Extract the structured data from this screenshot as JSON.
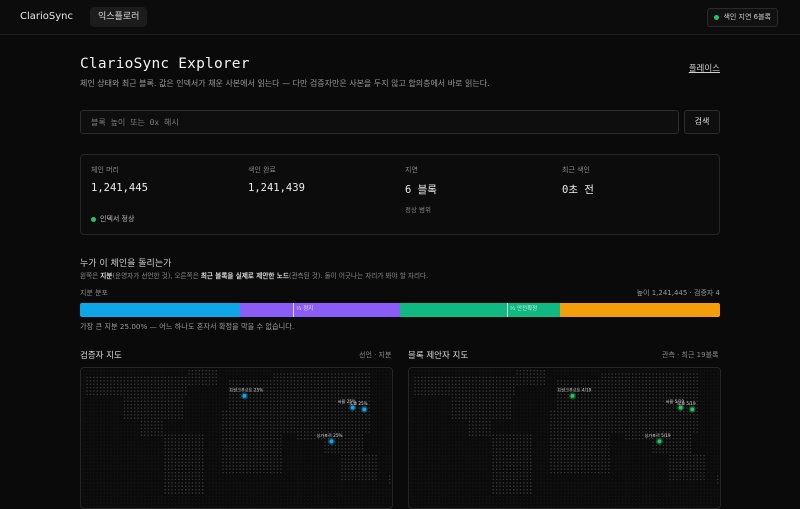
{
  "app": {
    "brand": "ClarioSync",
    "nav_tab": "익스플로러",
    "indexer_lag": "색인 지연 6블록"
  },
  "header": {
    "title": "ClarioSync Explorer",
    "subtitle": "체인 상태와 최근 블록. 값은 인덱서가 채운 사본에서 읽는다 — 다만 검증자만은 사본을 두지 않고 합의층에서 바로 읽는다.",
    "playbook_link": "플레이스"
  },
  "search": {
    "placeholder": "블록 높이 또는 0x 해시",
    "button": "검색"
  },
  "stats": {
    "chain_head": {
      "label": "체인 머리",
      "value": "1,241,445"
    },
    "indexed": {
      "label": "색인 완료",
      "value": "1,241,439"
    },
    "lag": {
      "label": "지연",
      "value": "6 블록",
      "note": "정상 범위"
    },
    "last_indexed": {
      "label": "최근 색인",
      "value": "0초 전"
    },
    "indexer_status": "인덱서 정상"
  },
  "control": {
    "title": "누가 이 체인을 돌리는가",
    "desc_1": "왼쪽은 ",
    "desc_bold_1": "지분",
    "desc_2": "(운영자가 선언한 것), 오른쪽은 ",
    "desc_bold_2": "최근 블록을 실제로 제안한 노드",
    "desc_3": "(관측된 것). 둘이 어긋나는 자리가 봐야 할 자리다.",
    "distribution_label": "지분 분포",
    "height_info": "높이 1,241,445 · 검증자 4",
    "stake_shares": [
      {
        "share": 0.25,
        "color": "#0ea5e9"
      },
      {
        "share": 0.25,
        "color": "#8b5cf6"
      },
      {
        "share": 0.25,
        "color": "#10b981"
      },
      {
        "share": 0.25,
        "color": "#f59e0b"
      }
    ],
    "thresholds": [
      {
        "position": 0.333,
        "label": "⅓ 정지"
      },
      {
        "position": 0.667,
        "label": "⅔ 안전확정"
      }
    ],
    "caption": "가장 큰 지분 25.00% — 어느 하나도 혼자서 확정을 막을 수 없습니다."
  },
  "validator_map": {
    "title": "검증자 지도",
    "subtitle": "선언 · 지분",
    "pin_color": "#0ea5e9",
    "pins": [
      {
        "label": "프랑크푸르트 25%",
        "lon": 8.7,
        "lat": 50.1
      },
      {
        "label": "서울 25%",
        "lon": 127.0,
        "lat": 37.6
      },
      {
        "label": "도쿄 25%",
        "lon": 139.7,
        "lat": 35.7
      },
      {
        "label": "싱가포르 25%",
        "lon": 103.8,
        "lat": 1.35
      }
    ]
  },
  "proposer_map": {
    "title": "블록 제안자 지도",
    "subtitle": "관측 · 최근 19블록",
    "pin_color": "#22c55e",
    "pins": [
      {
        "label": "프랑크푸르트 4/19",
        "lon": 8.7,
        "lat": 50.1
      },
      {
        "label": "서울 5/19",
        "lon": 127.0,
        "lat": 37.6
      },
      {
        "label": "도쿄 5/19",
        "lon": 139.7,
        "lat": 35.7
      },
      {
        "label": "싱가포르 5/19",
        "lon": 103.8,
        "lat": 1.35
      }
    ]
  }
}
